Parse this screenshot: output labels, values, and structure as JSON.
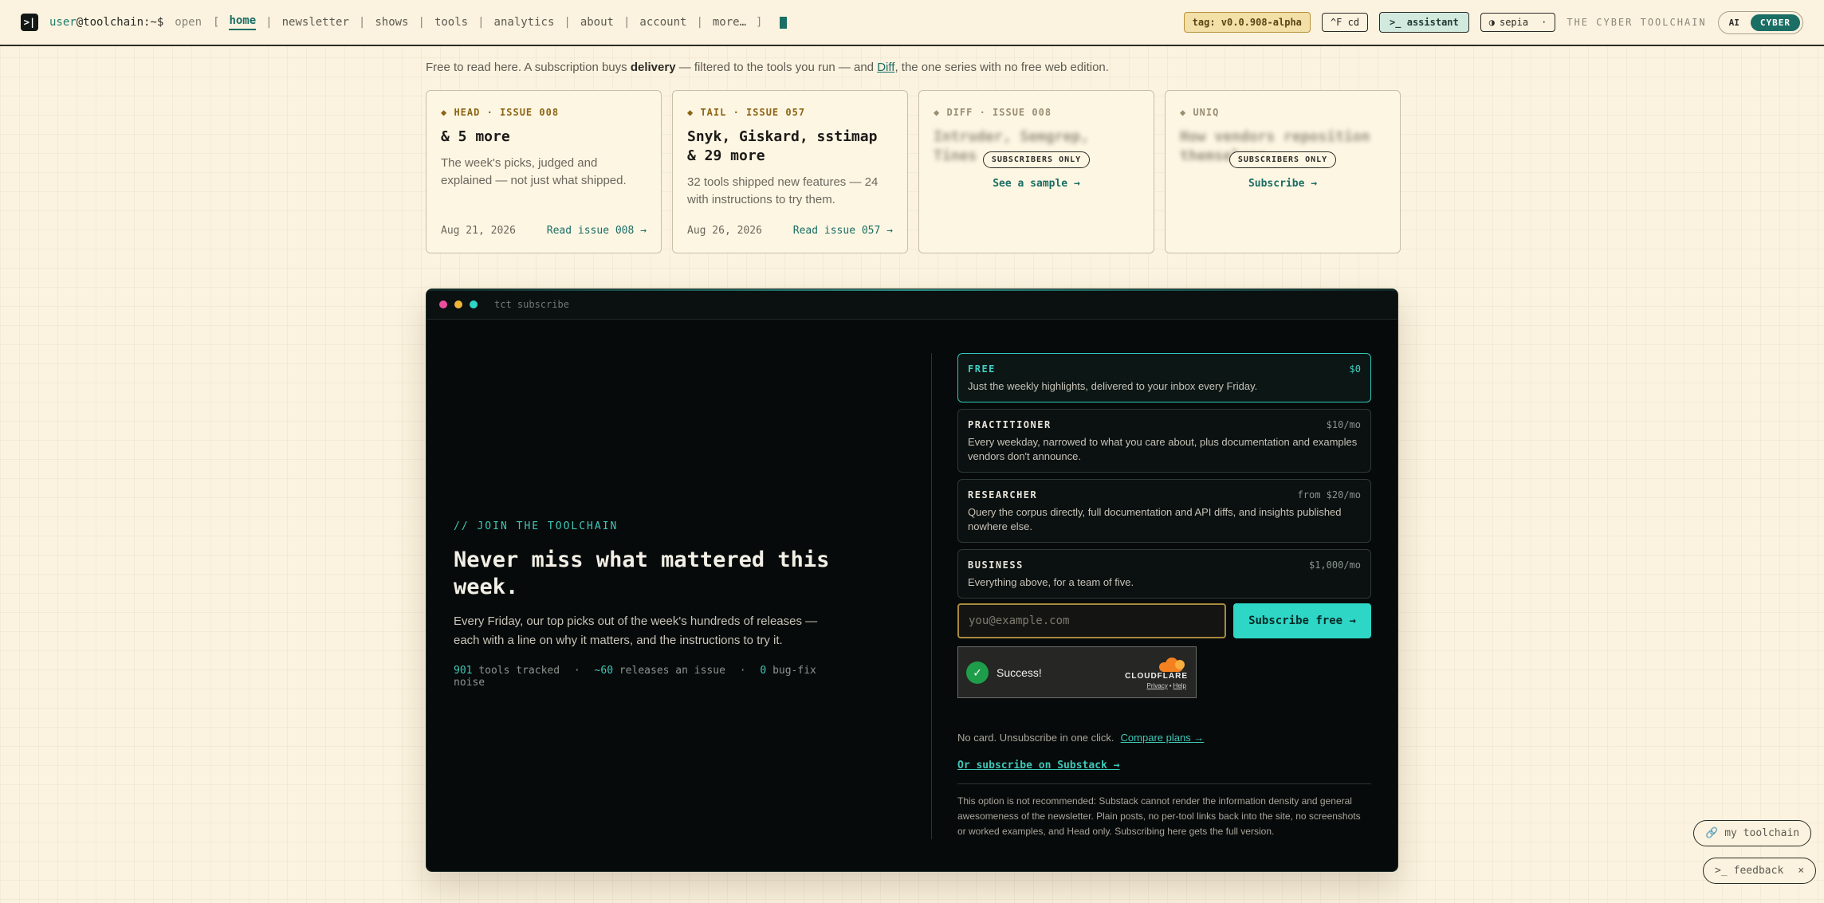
{
  "nav": {
    "user": "user",
    "host": "@toolchain:~$",
    "open": "open",
    "lbracket": "[",
    "rbracket": "]",
    "links": [
      "home",
      "newsletter",
      "shows",
      "tools",
      "analytics",
      "about",
      "account"
    ],
    "more": "more…",
    "tag": "tag: v0.0.908-alpha",
    "cd": "^F cd",
    "assistant": ">_ assistant",
    "theme": "sepia",
    "theme_icon": "◑",
    "theme_caret": "·",
    "brand": "THE CYBER TOOLCHAIN",
    "toggle_off": "AI",
    "toggle_on": "CYBER",
    "logo_icon": ">|"
  },
  "intro": {
    "pre": "Free to read here. A subscription buys",
    "bold": "delivery",
    "mid": "— filtered to the tools you run — and",
    "link": "Diff",
    "post": ", the one series with no free web edition."
  },
  "cards": [
    {
      "kicker": "◆ HEAD · ISSUE 008",
      "title": "& 5 more",
      "desc": "The week's picks, judged and explained — not just what shipped.",
      "date": "Aug 21, 2026",
      "read": "Read issue 008 →"
    },
    {
      "kicker": "◆ TAIL · ISSUE 057",
      "title": "Snyk, Giskard, sstimap & 29 more",
      "desc": "32 tools shipped new features — 24 with instructions to try them.",
      "date": "Aug 26, 2026",
      "read": "Read issue 057 →"
    },
    {
      "kicker": "◆ DIFF · ISSUE 008",
      "blur": "Intruder, Semgrep, Tines",
      "badge": "SUBSCRIBERS ONLY",
      "link": "See a sample →"
    },
    {
      "kicker": "◆ UNIQ",
      "blur": "How vendors reposition themselves",
      "badge": "SUBSCRIBERS ONLY",
      "link": "Subscribe →"
    }
  ],
  "term": {
    "title": "tct subscribe",
    "kicker": "// JOIN THE TOOLCHAIN",
    "heading": "Never miss what mattered this week.",
    "para": "Every Friday, our top picks out of the week's hundreds of releases — each with a line on why it matters, and the instructions to try it.",
    "stats": [
      {
        "n": "901",
        "label": "tools tracked"
      },
      {
        "n": "~60",
        "label": "releases an issue"
      },
      {
        "n": "0",
        "label": "bug-fix noise"
      }
    ],
    "stat_sep": "·"
  },
  "plans": [
    {
      "name": "FREE",
      "price": "$0",
      "desc": "Just the weekly highlights, delivered to your inbox every Friday."
    },
    {
      "name": "PRACTITIONER",
      "price": "$10/mo",
      "desc": "Every weekday, narrowed to what you care about, plus documentation and examples vendors don't announce."
    },
    {
      "name": "RESEARCHER",
      "price": "from $20/mo",
      "desc": "Query the corpus directly, full documentation and API diffs, and insights published nowhere else."
    },
    {
      "name": "BUSINESS",
      "price": "$1,000/mo",
      "desc": "Everything above, for a team of five."
    }
  ],
  "form": {
    "placeholder": "you@example.com",
    "button": "Subscribe free →"
  },
  "captcha": {
    "status": "Success!",
    "brand": "CLOUDFLARE",
    "privacy": "Privacy",
    "dot": "•",
    "help": "Help",
    "check": "✓"
  },
  "footer": {
    "nocard": "No card. Unsubscribe in one click.",
    "compare": "Compare plans →",
    "substack": "Or subscribe on Substack →",
    "note": "This option is not recommended: Substack cannot render the information density and general awesomeness of the newsletter. Plain posts, no per-tool links back into the site, no screenshots or worked examples, and Head only. Subscribing here gets the full version."
  },
  "floating": {
    "toolchain": "my toolchain",
    "toolchain_icon": "🔗",
    "feedback": "feedback",
    "feedback_icon": ">_",
    "close": "×"
  },
  "colors": {
    "accent": "#1a6e64",
    "accent_bright": "#2ed6c6",
    "background": "#fbf3df",
    "terminal": "#070a0a",
    "gold": "#8c6414"
  }
}
